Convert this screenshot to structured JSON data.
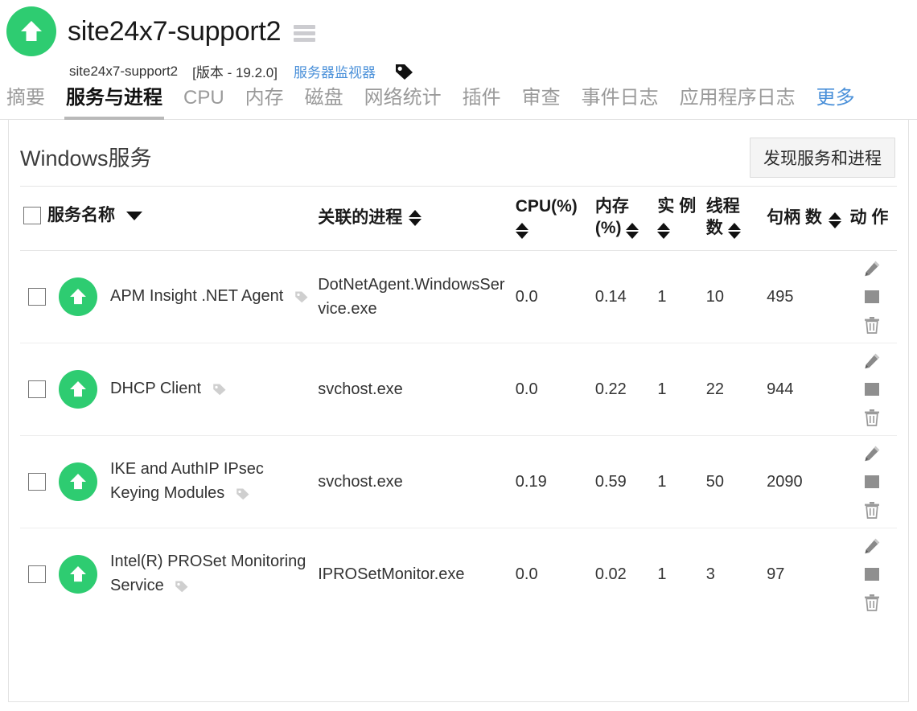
{
  "header": {
    "logo_icon": "green-up-arrow-logo",
    "host_title": "site24x7-support2",
    "menu_icon": "hamburger-menu-icon",
    "hostname": "site24x7-support2",
    "version": "[版本 - 19.2.0]",
    "monitor_link": "服务器监视器",
    "tag_icon": "tag-icon"
  },
  "tabs": [
    {
      "label": "摘要",
      "active": false,
      "link": false
    },
    {
      "label": "服务与进程",
      "active": true,
      "link": false
    },
    {
      "label": "CPU",
      "active": false,
      "link": false
    },
    {
      "label": "内存",
      "active": false,
      "link": false
    },
    {
      "label": "磁盘",
      "active": false,
      "link": false
    },
    {
      "label": "网络统计",
      "active": false,
      "link": false
    },
    {
      "label": "插件",
      "active": false,
      "link": false
    },
    {
      "label": "审查",
      "active": false,
      "link": false
    },
    {
      "label": "事件日志",
      "active": false,
      "link": false
    },
    {
      "label": "应用程序日志",
      "active": false,
      "link": false
    },
    {
      "label": "更多",
      "active": false,
      "link": true
    }
  ],
  "section": {
    "title": "Windows服务",
    "discover_button": "发现服务和进程"
  },
  "table": {
    "headers": {
      "name": "服务名称",
      "process": "关联的进程",
      "cpu": "CPU(%)",
      "memory": "内存 (%)",
      "instances": "实 例",
      "threads": "线程 数",
      "handles": "句柄 数",
      "actions": "动 作"
    },
    "rows": [
      {
        "status": "up",
        "name": "APM Insight .NET Agent",
        "process": "DotNetAgent.WindowsService.exe",
        "cpu": "0.0",
        "memory": "0.14",
        "instances": "1",
        "threads": "10",
        "handles": "495",
        "actions": [
          "edit-icon",
          "stop-icon",
          "delete-icon"
        ]
      },
      {
        "status": "up",
        "name": "DHCP Client",
        "process": "svchost.exe",
        "cpu": "0.0",
        "memory": "0.22",
        "instances": "1",
        "threads": "22",
        "handles": "944",
        "actions": [
          "edit-icon",
          "stop-icon",
          "delete-icon"
        ]
      },
      {
        "status": "up",
        "name": "IKE and AuthIP IPsec Keying Modules",
        "process": "svchost.exe",
        "cpu": "0.19",
        "memory": "0.59",
        "instances": "1",
        "threads": "50",
        "handles": "2090",
        "actions": [
          "edit-icon",
          "stop-icon",
          "delete-icon"
        ]
      },
      {
        "status": "up",
        "name": "Intel(R) PROSet Monitoring Service",
        "process": "IPROSetMonitor.exe",
        "cpu": "0.0",
        "memory": "0.02",
        "instances": "1",
        "threads": "3",
        "handles": "97",
        "actions": [
          "edit-icon",
          "stop-icon",
          "delete-icon"
        ]
      }
    ]
  },
  "colors": {
    "status_up": "#2ecc71",
    "link": "#4a90d9",
    "value": "#4a89dc",
    "hamburger": "#ccccd0"
  }
}
